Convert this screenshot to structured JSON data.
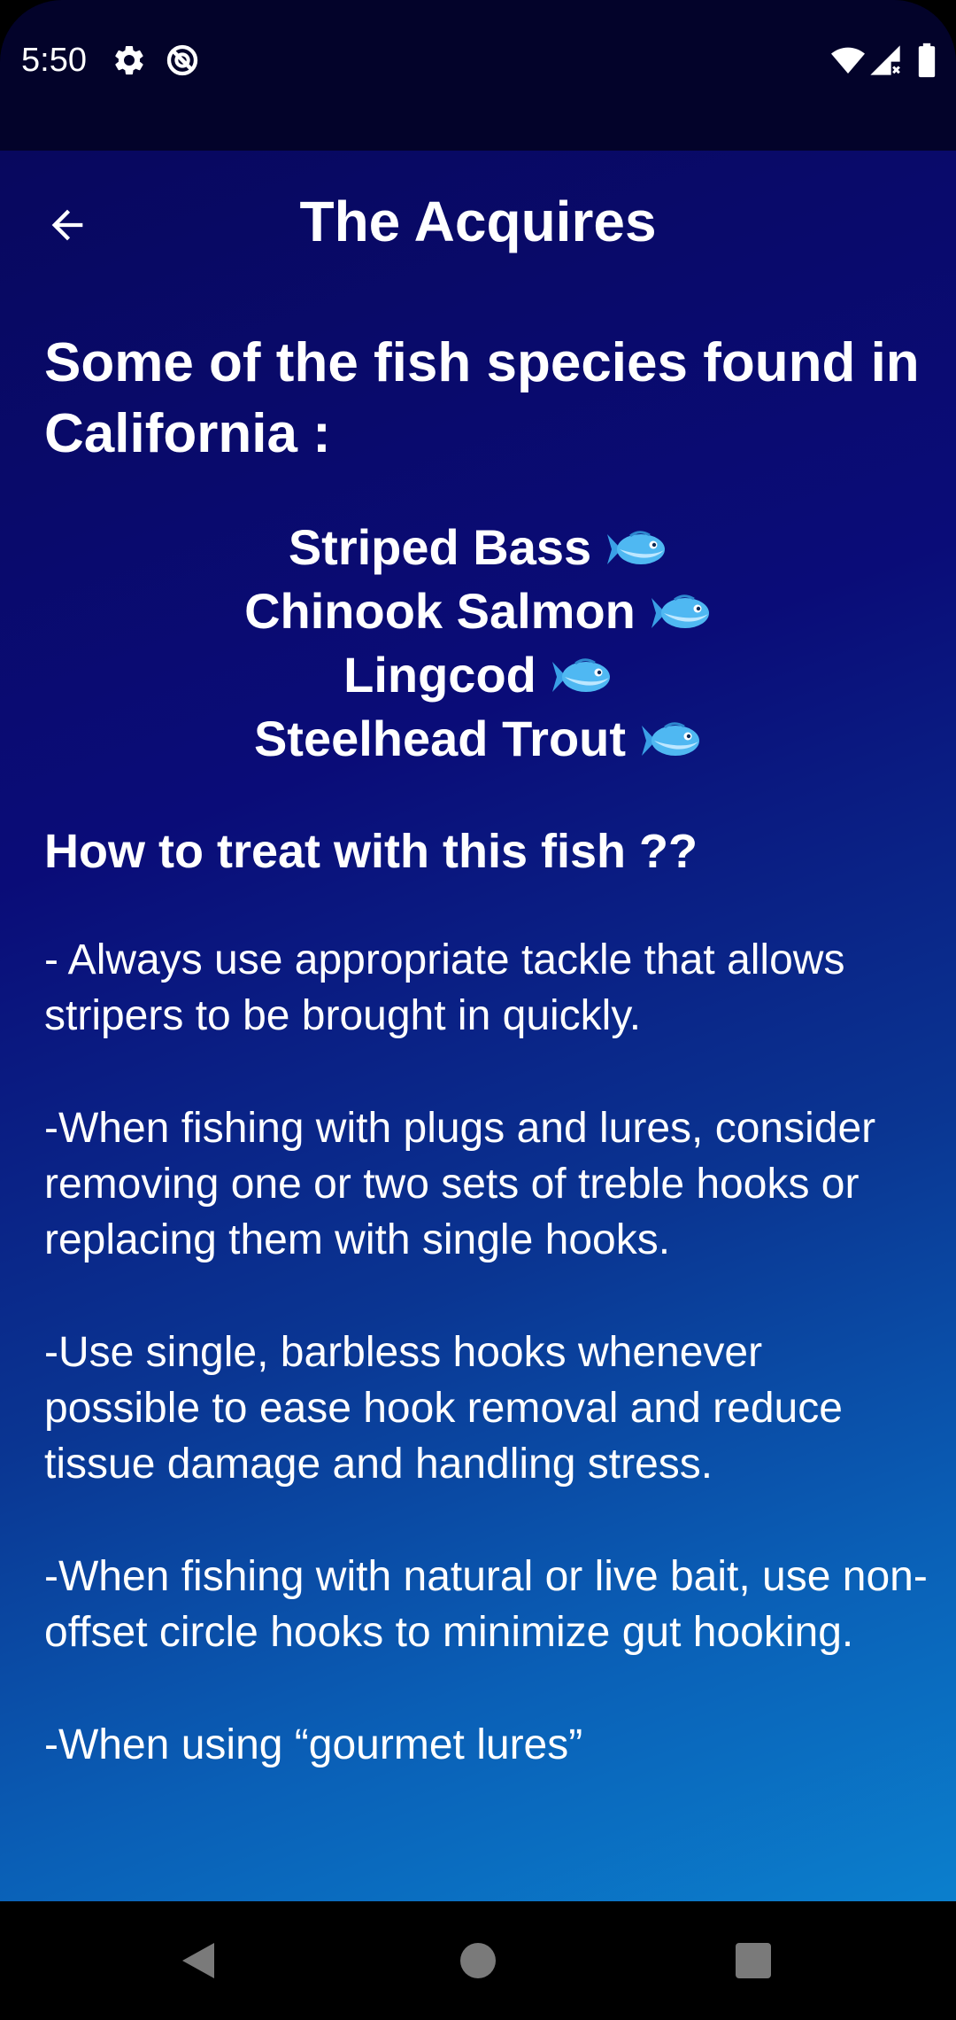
{
  "status_bar": {
    "time": "5:50",
    "left_icons": [
      "gear-icon",
      "do-not-disturb-icon"
    ],
    "right_icons": [
      "wifi-icon",
      "signal-icon",
      "battery-icon"
    ]
  },
  "app_bar": {
    "title": "The Acquires",
    "back_icon": "arrow-left-icon"
  },
  "content": {
    "heading": "Some of the  fish species found in California :",
    "species": [
      {
        "name": "Striped Bass",
        "icon": "fish-icon"
      },
      {
        "name": "Chinook Salmon",
        "icon": "fish-icon"
      },
      {
        "name": "Lingcod",
        "icon": "fish-icon"
      },
      {
        "name": "Steelhead Trout",
        "icon": "fish-icon"
      }
    ],
    "subheading": "How to treat with this fish ??",
    "tips": [
      "- Always use appropriate tackle that allows stripers to be brought in quickly.",
      "-When fishing with plugs and lures, consider removing one or two sets of treble hooks or replacing them with single hooks.",
      "-Use single, barbless hooks whenever possible to ease hook removal and reduce tissue damage and handling stress.",
      "-When fishing with natural or live bait, use non-offset circle hooks to minimize gut hooking.",
      "-When using “gourmet lures”"
    ]
  },
  "nav_bar": {
    "buttons": [
      "back-triangle-icon",
      "home-circle-icon",
      "recents-square-icon"
    ]
  },
  "colors": {
    "status_bar_bg": "#03032a",
    "gradient_top": "#08085e",
    "gradient_bottom": "#0b7fcd",
    "text": "#ffffff",
    "nav_icon": "#7a7a7a"
  }
}
